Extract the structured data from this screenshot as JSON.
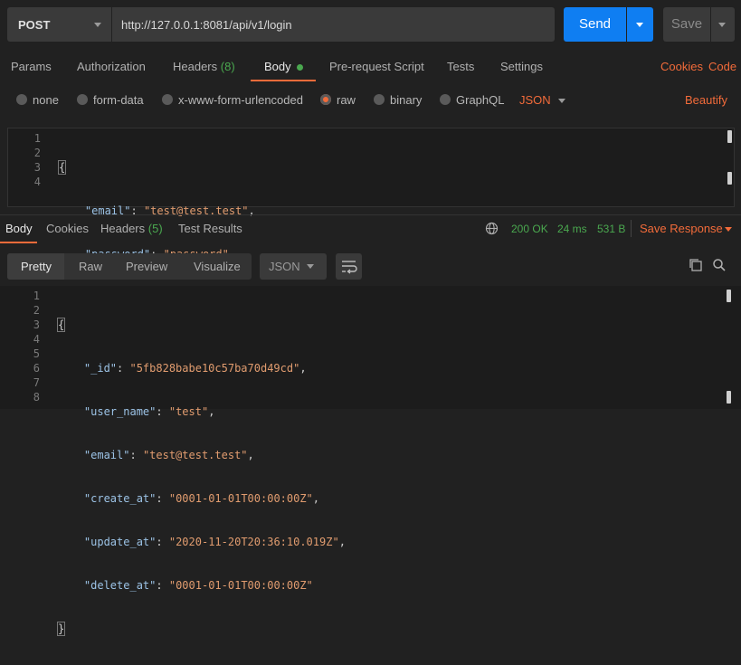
{
  "request": {
    "method": "POST",
    "url": "http://127.0.0.1:8081/api/v1/login",
    "send_label": "Send",
    "save_label": "Save"
  },
  "request_tabs": [
    {
      "label": "Params"
    },
    {
      "label": "Authorization"
    },
    {
      "label": "Headers",
      "count": "(8)"
    },
    {
      "label": "Body",
      "active": true
    },
    {
      "label": "Pre-request Script"
    },
    {
      "label": "Tests"
    },
    {
      "label": "Settings"
    }
  ],
  "right_links": {
    "cookies": "Cookies",
    "code": "Code"
  },
  "body_types": {
    "none": "none",
    "form_data": "form-data",
    "urlencoded": "x-www-form-urlencoded",
    "raw": "raw",
    "binary": "binary",
    "graphql": "GraphQL",
    "format": "JSON",
    "beautify": "Beautify"
  },
  "request_body": {
    "line_numbers": [
      "1",
      "2",
      "3",
      "4"
    ],
    "lines": [
      {
        "open": "{"
      },
      {
        "key": "\"email\"",
        "sep": ": ",
        "value": "\"test@test.test\"",
        "tail": ","
      },
      {
        "key": "\"password\"",
        "sep": ": ",
        "value": "\"password\"",
        "tail": ""
      },
      {
        "close": "}"
      }
    ]
  },
  "response_tabs": {
    "body": "Body",
    "cookies": "Cookies",
    "headers": "Headers",
    "headers_count": "(5)",
    "test_results": "Test Results"
  },
  "response_status": {
    "status": "200 OK",
    "time": "24 ms",
    "size": "531 B",
    "save_response": "Save Response"
  },
  "view_modes": {
    "pretty": "Pretty",
    "raw": "Raw",
    "preview": "Preview",
    "visualize": "Visualize",
    "format": "JSON"
  },
  "response_body": {
    "line_numbers": [
      "1",
      "2",
      "3",
      "4",
      "5",
      "6",
      "7",
      "8"
    ],
    "lines": [
      {
        "open": "{"
      },
      {
        "key": "\"_id\"",
        "sep": ": ",
        "value": "\"5fb828babe10c57ba70d49cd\"",
        "tail": ","
      },
      {
        "key": "\"user_name\"",
        "sep": ": ",
        "value": "\"test\"",
        "tail": ","
      },
      {
        "key": "\"email\"",
        "sep": ": ",
        "value": "\"test@test.test\"",
        "tail": ","
      },
      {
        "key": "\"create_at\"",
        "sep": ": ",
        "value": "\"0001-01-01T00:00:00Z\"",
        "tail": ","
      },
      {
        "key": "\"update_at\"",
        "sep": ": ",
        "value": "\"2020-11-20T20:36:10.019Z\"",
        "tail": ","
      },
      {
        "key": "\"delete_at\"",
        "sep": ": ",
        "value": "\"0001-01-01T00:00:00Z\"",
        "tail": ""
      },
      {
        "close": "}"
      }
    ]
  },
  "colors": {
    "accent": "#f26b3a",
    "primary_button": "#0f7ef2",
    "success": "#4aa84f",
    "json_key": "#9cc3e6",
    "json_string": "#e19c6f"
  }
}
